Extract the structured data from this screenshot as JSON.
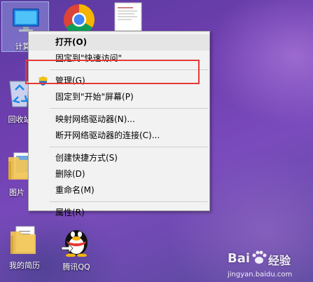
{
  "desktop": {
    "icons": [
      {
        "label": "计算机",
        "icon": "computer-icon"
      },
      {
        "label": "Google Chrome",
        "icon": "chrome-icon"
      },
      {
        "label": "",
        "icon": "document-thumbnail-icon"
      },
      {
        "label": "回收站",
        "icon": "recycle-bin-icon"
      },
      {
        "label": "图片",
        "icon": "folder-icon"
      },
      {
        "label": "我的简历",
        "icon": "folder-icon"
      },
      {
        "label": "腾讯QQ",
        "icon": "qq-penguin-icon"
      }
    ]
  },
  "context_menu": {
    "items": [
      {
        "label": "打开(O)",
        "bold": true
      },
      {
        "label": "固定到\"快速访问\""
      },
      {
        "label": "管理(G)",
        "icon": "uac-shield-icon",
        "highlighted_box": true
      },
      {
        "label": "固定到\"开始\"屏幕(P)"
      },
      {
        "label": "映射网络驱动器(N)..."
      },
      {
        "label": "断开网络驱动器的连接(C)..."
      },
      {
        "label": "创建快捷方式(S)"
      },
      {
        "label": "删除(D)"
      },
      {
        "label": "重命名(M)"
      },
      {
        "label": "属性(R)"
      }
    ]
  },
  "watermark": {
    "brand": "Bai",
    "brand2": "经验",
    "url": "jingyan.baidu.com"
  },
  "colors": {
    "highlight_box": "#e53935",
    "menu_bg": "#f2f2f2"
  }
}
